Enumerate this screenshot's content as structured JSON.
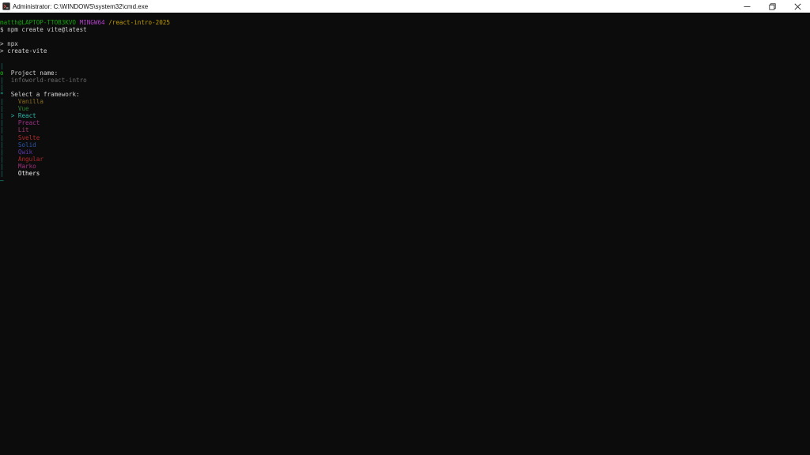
{
  "window": {
    "title": "Administrator:  C:\\WINDOWS\\system32\\cmd.exe",
    "controls": {
      "minimize": "–",
      "restore": "❐",
      "close": "✕"
    }
  },
  "terminal": {
    "prompt": {
      "user_host": "matth@LAPTOP-TTOB3KVO",
      "system": "MINGW64",
      "path": "/react-intro-2025"
    },
    "command_line": "$ npm create vite@latest",
    "npx_line": "> npx",
    "create_vite_line": "> create-vite",
    "gutter_bar": "|",
    "project_bullet": "o",
    "project_label": "Project name:",
    "project_value": "infoworld-react-intro",
    "framework_bullet": "*",
    "framework_label": "Select a framework:",
    "selector": ">",
    "frameworks": [
      {
        "label": "Vanilla",
        "selected": false,
        "color": "#8a6d1e"
      },
      {
        "label": "Vue",
        "selected": false,
        "color": "#2e7d32"
      },
      {
        "label": "React",
        "selected": true,
        "color": "#2ab5a5"
      },
      {
        "label": "Preact",
        "selected": false,
        "color": "#a0308a"
      },
      {
        "label": "Lit",
        "selected": false,
        "color": "#a33a6e"
      },
      {
        "label": "Svelte",
        "selected": false,
        "color": "#b02a2a"
      },
      {
        "label": "Solid",
        "selected": false,
        "color": "#2a55a8"
      },
      {
        "label": "Qwik",
        "selected": false,
        "color": "#5a3aa8"
      },
      {
        "label": "Angular",
        "selected": false,
        "color": "#b0282a"
      },
      {
        "label": "Marko",
        "selected": false,
        "color": "#a0307a"
      },
      {
        "label": "Others",
        "selected": false,
        "color": "#f2f2f2"
      }
    ],
    "end_marker": "—"
  },
  "colors": {
    "background": "#0c0c0c",
    "titlebar": "#ffffff",
    "prompt_user": "#13a10e",
    "prompt_system": "#b140c8",
    "prompt_path": "#c19c00"
  }
}
